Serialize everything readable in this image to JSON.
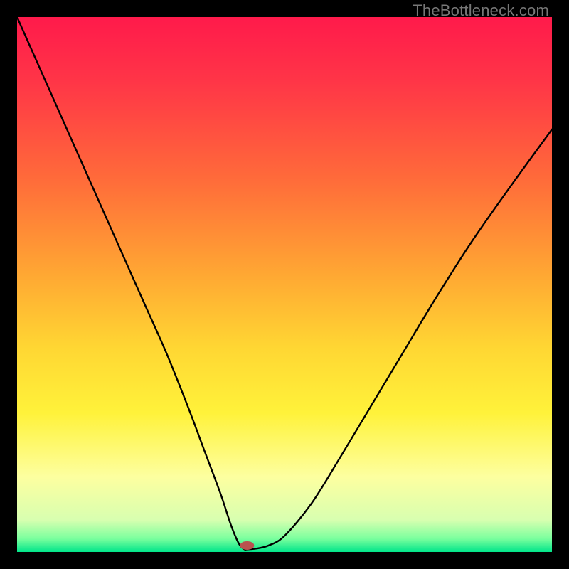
{
  "watermark": "TheBottleneck.com",
  "chart_data": {
    "type": "line",
    "title": "",
    "xlabel": "",
    "ylabel": "",
    "xlim": [
      0,
      100
    ],
    "ylim": [
      0,
      100
    ],
    "gradient_stops": [
      {
        "offset": 0.0,
        "color": "#ff1a4b"
      },
      {
        "offset": 0.12,
        "color": "#ff3547"
      },
      {
        "offset": 0.3,
        "color": "#ff6a3a"
      },
      {
        "offset": 0.48,
        "color": "#ffa733"
      },
      {
        "offset": 0.62,
        "color": "#ffd733"
      },
      {
        "offset": 0.74,
        "color": "#fff23a"
      },
      {
        "offset": 0.86,
        "color": "#fdffa0"
      },
      {
        "offset": 0.94,
        "color": "#d8ffb0"
      },
      {
        "offset": 0.975,
        "color": "#7bff9e"
      },
      {
        "offset": 1.0,
        "color": "#00e58a"
      }
    ],
    "series": [
      {
        "name": "curve",
        "x": [
          0,
          4,
          8,
          12,
          16,
          20,
          24,
          28,
          32,
          35,
          38,
          40,
          41.5,
          42.5,
          43.0,
          44.5,
          47,
          50,
          55,
          60,
          66,
          72,
          78,
          85,
          92,
          100
        ],
        "y": [
          100,
          91,
          82,
          73,
          64,
          55,
          46,
          37,
          27,
          19,
          11,
          5,
          1.5,
          0.5,
          0.5,
          0.6,
          1.2,
          3,
          9,
          17,
          27,
          37,
          47,
          58,
          68,
          79
        ]
      }
    ],
    "marker": {
      "x": 43.0,
      "y": 1.2,
      "color": "#b9524f",
      "rx": 10,
      "ry": 6
    }
  }
}
